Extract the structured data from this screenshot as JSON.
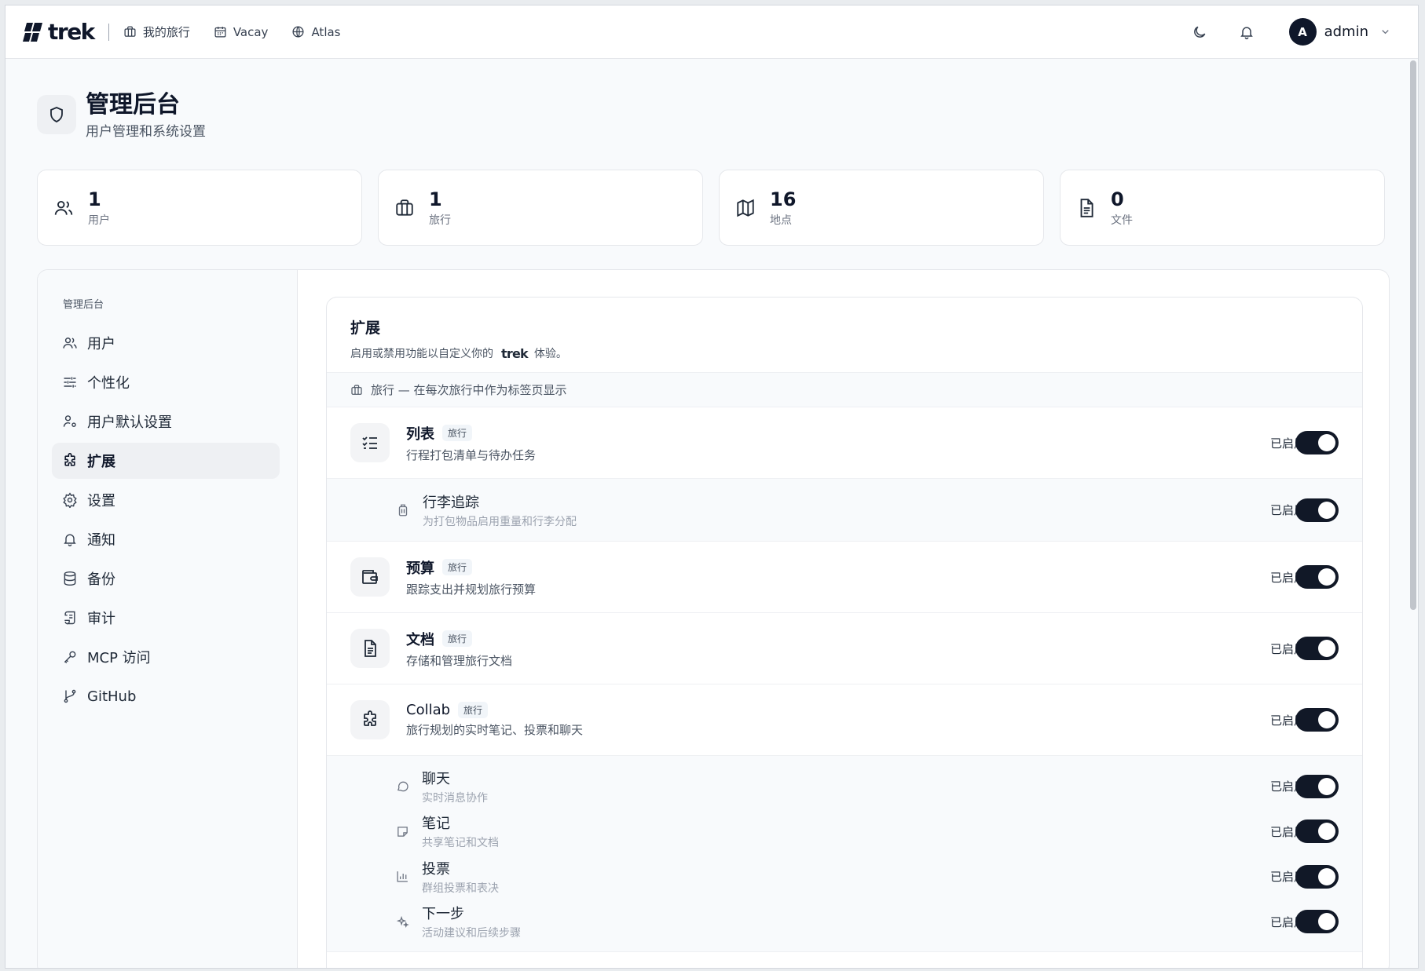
{
  "brand": {
    "name": "trek"
  },
  "nav": {
    "items": [
      {
        "label": "我的旅行",
        "icon": "briefcase-icon"
      },
      {
        "label": "Vacay",
        "icon": "calendar-icon"
      },
      {
        "label": "Atlas",
        "icon": "globe-icon"
      }
    ]
  },
  "topbar": {
    "theme_icon": "moon-icon",
    "notif_icon": "bell-icon",
    "avatar_letter": "A",
    "username": "admin"
  },
  "header": {
    "title": "管理后台",
    "subtitle": "用户管理和系统设置"
  },
  "stats": [
    {
      "value": "1",
      "label": "用户",
      "icon": "users-icon"
    },
    {
      "value": "1",
      "label": "旅行",
      "icon": "briefcase-icon"
    },
    {
      "value": "16",
      "label": "地点",
      "icon": "map-icon"
    },
    {
      "value": "0",
      "label": "文件",
      "icon": "file-icon"
    }
  ],
  "sidebar": {
    "title": "管理后台",
    "items": [
      {
        "label": "用户",
        "icon": "users-icon"
      },
      {
        "label": "个性化",
        "icon": "sliders-icon"
      },
      {
        "label": "用户默认设置",
        "icon": "user-cog-icon"
      },
      {
        "label": "扩展",
        "icon": "puzzle-icon",
        "active": true
      },
      {
        "label": "设置",
        "icon": "gear-icon"
      },
      {
        "label": "通知",
        "icon": "bell-icon"
      },
      {
        "label": "备份",
        "icon": "database-icon"
      },
      {
        "label": "审计",
        "icon": "scroll-icon"
      },
      {
        "label": "MCP 访问",
        "icon": "key-icon"
      },
      {
        "label": "GitHub",
        "icon": "git-branch-icon"
      }
    ]
  },
  "content": {
    "title": "扩展",
    "desc_before": "启用或禁用功能以自定义你的",
    "desc_brand": "trek",
    "desc_after": "体验。",
    "section": "旅行 — 在每次旅行中作为标签页显示",
    "state_label": "已启用",
    "addons": {
      "list": {
        "name": "列表",
        "tag": "旅行",
        "desc": "行程打包清单与待办任务",
        "enabled": true
      },
      "luggage": {
        "name": "行李追踪",
        "desc": "为打包物品启用重量和行李分配",
        "enabled": true
      },
      "budget": {
        "name": "预算",
        "tag": "旅行",
        "desc": "跟踪支出并规划旅行预算",
        "enabled": true
      },
      "docs": {
        "name": "文档",
        "tag": "旅行",
        "desc": "存储和管理旅行文档",
        "enabled": true
      },
      "collab": {
        "name": "Collab",
        "tag": "旅行",
        "desc": "旅行规划的实时笔记、投票和聊天",
        "enabled": true
      },
      "chat": {
        "name": "聊天",
        "desc": "实时消息协作",
        "enabled": true
      },
      "notes": {
        "name": "笔记",
        "desc": "共享笔记和文档",
        "enabled": true
      },
      "polls": {
        "name": "投票",
        "desc": "群组投票和表决",
        "enabled": true
      },
      "next": {
        "name": "下一步",
        "desc": "活动建议和后续步骤",
        "enabled": true
      }
    }
  }
}
